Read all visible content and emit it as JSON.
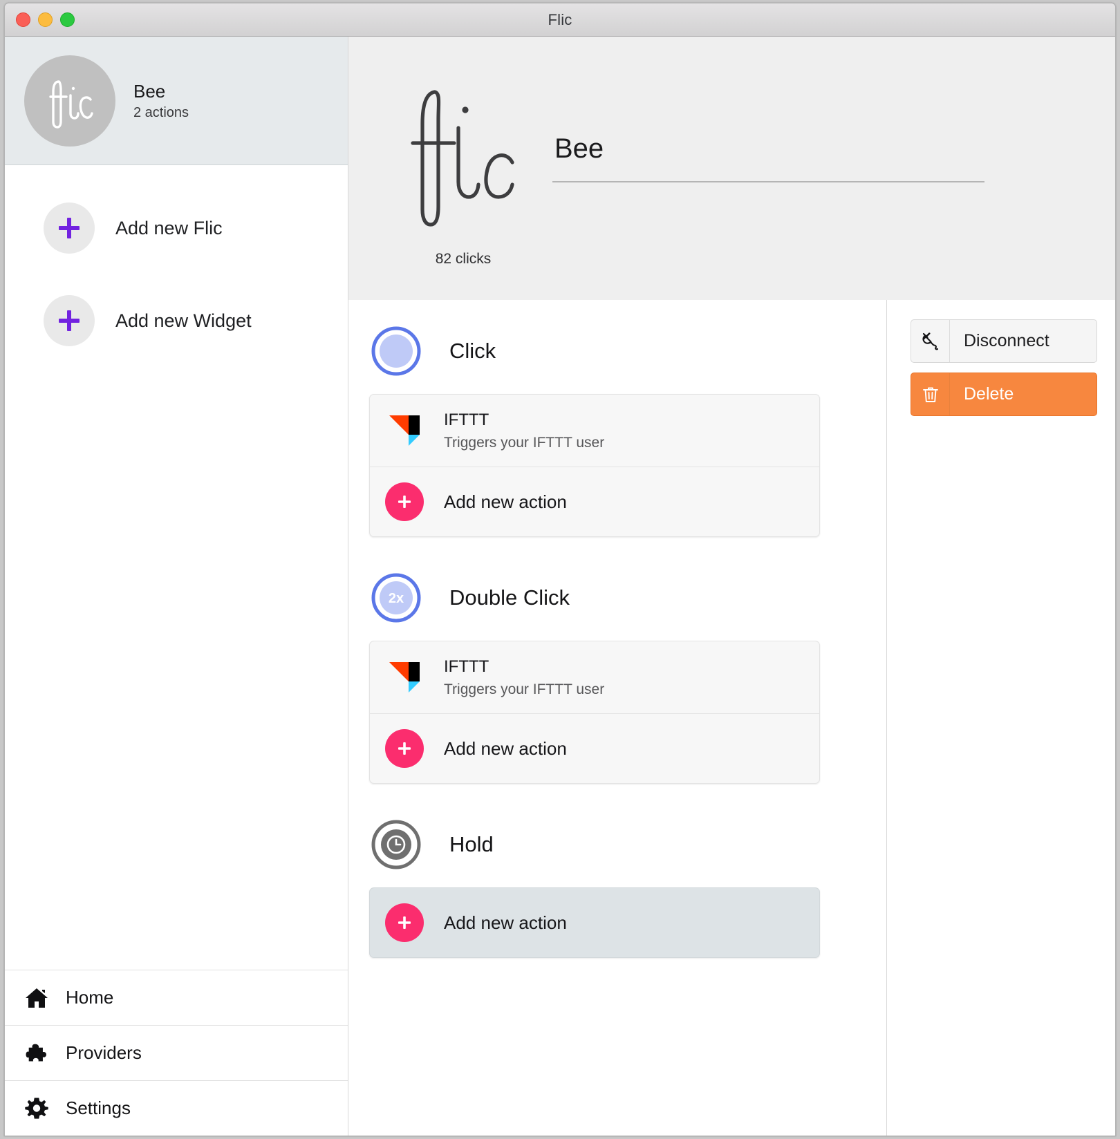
{
  "window": {
    "title": "Flic",
    "controls": [
      "close-button",
      "minimize-button",
      "maximize-button"
    ]
  },
  "sidebar": {
    "device": {
      "name": "Bee",
      "subtitle": "2 actions",
      "avatar_icon": "flic-logo-icon"
    },
    "actions": [
      {
        "label": "Add new Flic",
        "icon": "plus-icon"
      },
      {
        "label": "Add new Widget",
        "icon": "plus-icon"
      }
    ],
    "nav": [
      {
        "label": "Home",
        "icon": "home-icon"
      },
      {
        "label": "Providers",
        "icon": "puzzle-piece-icon"
      },
      {
        "label": "Settings",
        "icon": "gear-icon"
      }
    ]
  },
  "main": {
    "header": {
      "logo_icon": "flic-script-logo-icon",
      "click_count": "82 clicks",
      "name_value": "Bee",
      "name_placeholder": "Name"
    },
    "groups": [
      {
        "title": "Click",
        "icon": "single-click-icon",
        "icon_badge": "",
        "highlight": false,
        "rows": [
          {
            "type": "provider",
            "icon": "ifttt-logo-icon",
            "title": "IFTTT",
            "subtitle": "Triggers your IFTTT user"
          },
          {
            "type": "add",
            "icon": "plus-icon",
            "label": "Add new action"
          }
        ]
      },
      {
        "title": "Double Click",
        "icon": "double-click-icon",
        "icon_badge": "2x",
        "highlight": false,
        "rows": [
          {
            "type": "provider",
            "icon": "ifttt-logo-icon",
            "title": "IFTTT",
            "subtitle": "Triggers your IFTTT user"
          },
          {
            "type": "add",
            "icon": "plus-icon",
            "label": "Add new action"
          }
        ]
      },
      {
        "title": "Hold",
        "icon": "hold-clock-icon",
        "icon_badge": "",
        "highlight": true,
        "rows": [
          {
            "type": "add",
            "icon": "plus-icon",
            "label": "Add new action"
          }
        ]
      }
    ],
    "aside": {
      "disconnect": {
        "label": "Disconnect",
        "icon": "unplug-icon"
      },
      "delete": {
        "label": "Delete",
        "icon": "trash-icon"
      }
    }
  },
  "colors": {
    "accent_purple": "#7222e0",
    "accent_pink": "#fb2d6e",
    "danger_orange": "#f7873f",
    "click_blue": "#5b77e8",
    "click_fill": "#bfcaf7",
    "hold_gray": "#6f6f6f",
    "selected_bg": "#e6eaec",
    "header_bg": "#efefef",
    "ifttt_orange": "#ff3c00",
    "ifttt_black": "#000000",
    "ifttt_cyan": "#33ccff"
  }
}
